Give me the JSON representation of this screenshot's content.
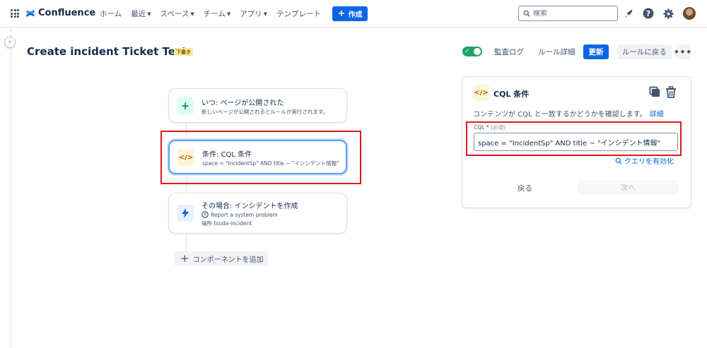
{
  "topnav": {
    "brand": "Confluence",
    "items": [
      {
        "label": "ホーム",
        "dropdown": false
      },
      {
        "label": "最近",
        "dropdown": true
      },
      {
        "label": "スペース",
        "dropdown": true
      },
      {
        "label": "チーム",
        "dropdown": true
      },
      {
        "label": "アプリ",
        "dropdown": true
      },
      {
        "label": "テンプレート",
        "dropdown": false
      }
    ],
    "create_label": "作成",
    "search_placeholder": "検索"
  },
  "page": {
    "title": "Create incident Ticket Test",
    "draft_badge": "下書き",
    "toggle_enabled": true,
    "audit_log": "監査ログ",
    "rule_details": "ルール詳細",
    "update": "更新",
    "back_to_rules": "ルールに戻る"
  },
  "flow": {
    "trigger": {
      "title": "いつ: ページが公開された",
      "subtitle": "新しいページが公開されるとルールが実行されます。"
    },
    "condition": {
      "title": "条件: CQL 条件",
      "subtitle": "space = \"IncidentSp\" AND title ~ \"インシデント情報\""
    },
    "action": {
      "title": "その場合: インシデントを作成",
      "line1": "Report a system problem",
      "line2": "場所 tsuda-incident"
    },
    "add_component": "コンポーネントを追加"
  },
  "panel": {
    "title": "CQL 条件",
    "description": "コンテンツが CQL と一致するかどうかを確認します。",
    "details_link": "詳細",
    "field_label": "CQL",
    "field_required": "*",
    "field_hint": "(必須)",
    "cql_value": "space = \"IncidentSp\" AND title ~ \"インシデント情報\"",
    "validate_query": "クエリを有効化",
    "back": "戻る",
    "next": "次へ"
  },
  "colors": {
    "brand_blue": "#0c66e4",
    "toggle_green": "#22a06b",
    "highlight_red": "#e11919",
    "trigger_icon_bg": "#dcfff1",
    "condition_icon_bg": "#fff4d6",
    "action_icon_bg": "#e9f2ff"
  }
}
